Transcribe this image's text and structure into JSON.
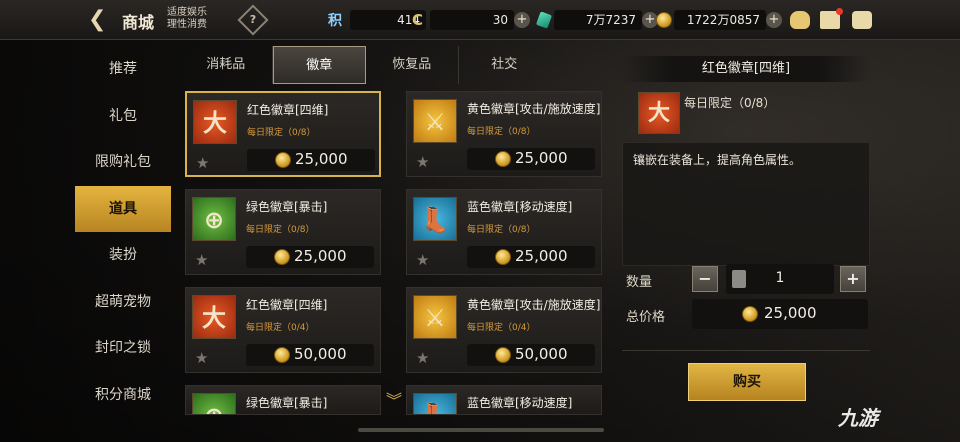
{
  "header": {
    "title": "商城",
    "notice_line1": "适度娱乐",
    "notice_line2": "理性消费",
    "help_symbol": "?"
  },
  "resources": [
    {
      "icon": "points-icon",
      "symbol": "积",
      "value": "414"
    },
    {
      "icon": "c-currency-icon",
      "symbol": "C",
      "value": "30"
    },
    {
      "icon": "gem-icon",
      "value": "7万7237"
    },
    {
      "icon": "gold-coin-icon",
      "value": "1722万0857"
    }
  ],
  "sidebar": {
    "items": [
      {
        "label": "推荐"
      },
      {
        "label": "礼包"
      },
      {
        "label": "限购礼包"
      },
      {
        "label": "道具",
        "active": true
      },
      {
        "label": "装扮"
      },
      {
        "label": "超萌宠物"
      },
      {
        "label": "封印之锁"
      },
      {
        "label": "积分商城"
      }
    ]
  },
  "tabs": [
    {
      "label": "消耗品"
    },
    {
      "label": "徽章",
      "active": true
    },
    {
      "label": "恢复品"
    },
    {
      "label": "社交"
    }
  ],
  "items": [
    {
      "name": "红色徽章[四维]",
      "limit": "每日限定（0/8）",
      "price": "25,000",
      "color": "red",
      "symbol": "大",
      "selected": true
    },
    {
      "name": "黄色徽章[攻击/施放速度]",
      "limit": "每日限定（0/8）",
      "price": "25,000",
      "color": "yellow",
      "symbol": "⚔"
    },
    {
      "name": "绿色徽章[暴击]",
      "limit": "每日限定（0/8）",
      "price": "25,000",
      "color": "green",
      "symbol": "⊕"
    },
    {
      "name": "蓝色徽章[移动速度]",
      "limit": "每日限定（0/8）",
      "price": "25,000",
      "color": "blue",
      "symbol": "👢"
    },
    {
      "name": "红色徽章[四维]",
      "limit": "每日限定（0/4）",
      "price": "50,000",
      "color": "red",
      "symbol": "大"
    },
    {
      "name": "黄色徽章[攻击/施放速度]",
      "limit": "每日限定（0/4）",
      "price": "50,000",
      "color": "yellow",
      "symbol": "⚔"
    },
    {
      "name": "绿色徽章[暴击]",
      "color": "green",
      "symbol": "⊕"
    },
    {
      "name": "蓝色徽章[移动速度]",
      "color": "blue",
      "symbol": "👢"
    }
  ],
  "detail": {
    "title": "红色徽章[四维]",
    "limit": "每日限定（0/8）",
    "symbol": "大",
    "description": "镶嵌在装备上，提高角色属性。",
    "quantity_label": "数量",
    "quantity": "1",
    "minus": "−",
    "plus": "+",
    "total_label": "总价格",
    "total": "25,000",
    "buy_label": "购买"
  },
  "watermark": "九游",
  "colors": {
    "accent_gold": "#d8b54c",
    "limit_orange": "#d69a3c",
    "notification_red": "#e73a2a"
  }
}
